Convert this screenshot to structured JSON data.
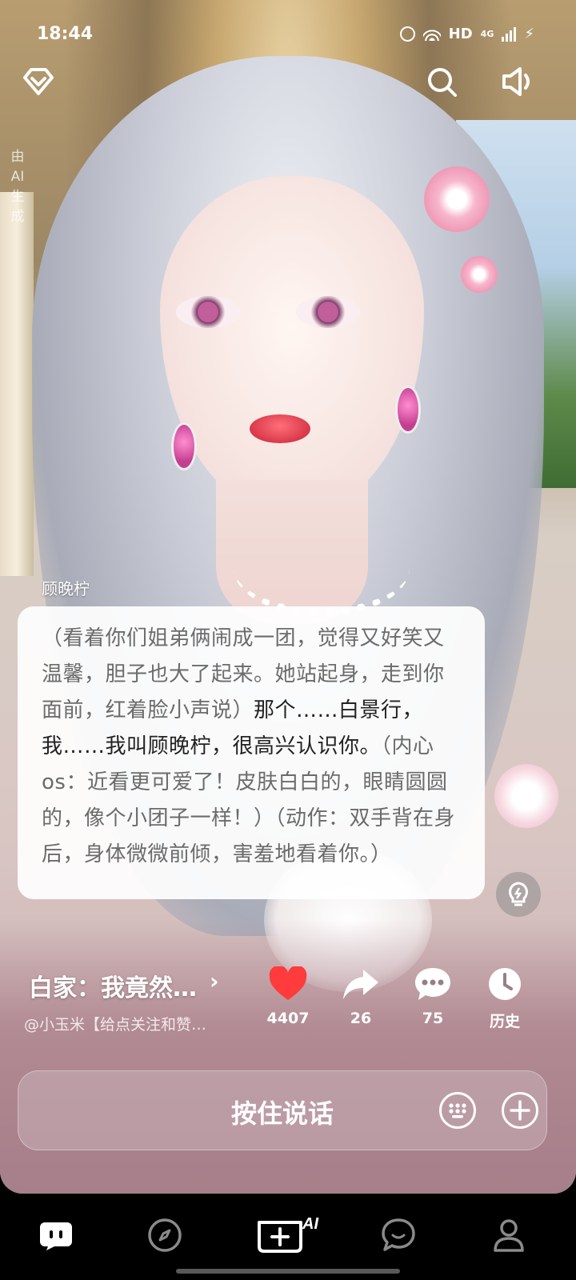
{
  "status_bar": {
    "time": "18:44",
    "hd": "HD",
    "network": "4G"
  },
  "ai_tag": [
    "由",
    "AI",
    "生",
    "成"
  ],
  "dialogue": {
    "speaker": "顾晚柠",
    "segments": [
      {
        "type": "narration",
        "text": "（看着你们姐弟俩闹成一团，觉得又好笑又温馨，胆子也大了起来。她站起身，走到你面前，红着脸小声说）"
      },
      {
        "type": "speech",
        "text": "那个……白景行，我……我叫顾晚柠，很高兴认识你。"
      },
      {
        "type": "narration",
        "text": "（内心os：近看更可爱了！皮肤白白的，眼睛圆圆的，像个小团子一样！）（动作：双手背在身后，身体微微前倾，害羞地看着你。）"
      }
    ]
  },
  "story": {
    "title": "白家：我竟然…",
    "author": "@小玉米【给点关注和赞…"
  },
  "actions": {
    "like_count": "4407",
    "share_count": "26",
    "comment_count": "75",
    "history_label": "历史"
  },
  "input": {
    "hold_to_talk": "按住说话"
  },
  "nav": {
    "ai_label": "AI"
  },
  "colors": {
    "like_red": "#ff3b3b",
    "bubble_bg": "#ffffff",
    "nav_bg": "#000000"
  },
  "icons": [
    "diamond-badge-icon",
    "search-icon",
    "speaker-icon",
    "heart-icon",
    "share-icon",
    "comment-icon",
    "clock-icon",
    "keyboard-icon",
    "plus-icon",
    "chat-bot-icon",
    "compass-icon",
    "create-ai-icon",
    "message-icon",
    "profile-icon"
  ]
}
